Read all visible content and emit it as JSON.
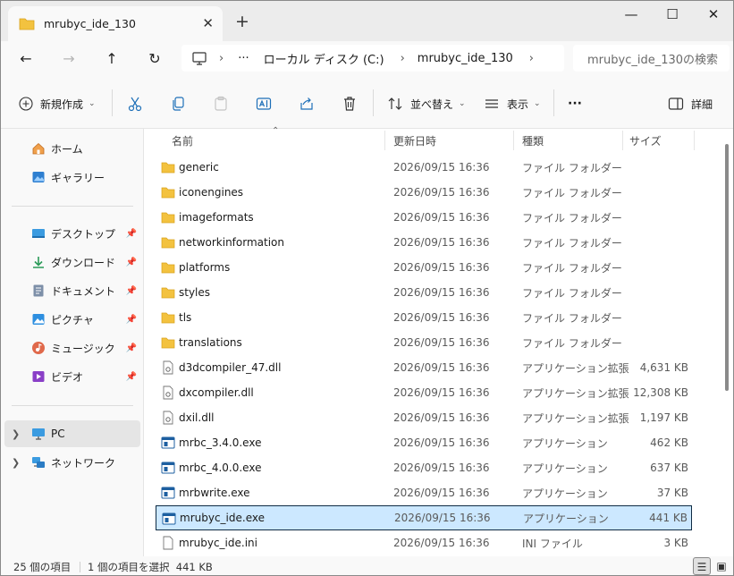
{
  "tab": {
    "title": "mrubyc_ide_130"
  },
  "window": {
    "minimize": "—",
    "maximize": "☐",
    "close": "✕",
    "new_tab": "+",
    "tab_close": "✕"
  },
  "nav": {
    "back": "←",
    "forward": "→",
    "up": "↑",
    "refresh": "↻"
  },
  "address": {
    "overflow": "···",
    "sep": "›",
    "crumbs": [
      "ローカル ディスク (C:)",
      "mrubyc_ide_130"
    ]
  },
  "search": {
    "placeholder": "mrubyc_ide_130の検索"
  },
  "toolbar": {
    "new": "新規作成",
    "sort": "並べ替え",
    "view": "表示",
    "more": "···",
    "details": "詳細"
  },
  "sidebar": {
    "home": "ホーム",
    "gallery": "ギャラリー",
    "quick": [
      "デスクトップ",
      "ダウンロード",
      "ドキュメント",
      "ピクチャ",
      "ミュージック",
      "ビデオ"
    ],
    "pc": "PC",
    "network": "ネットワーク"
  },
  "columns": {
    "name": "名前",
    "date": "更新日時",
    "type": "種類",
    "size": "サイズ"
  },
  "files": [
    {
      "name": "generic",
      "date": "2026/09/15 16:36",
      "type": "ファイル フォルダー",
      "size": "",
      "kind": "folder"
    },
    {
      "name": "iconengines",
      "date": "2026/09/15 16:36",
      "type": "ファイル フォルダー",
      "size": "",
      "kind": "folder"
    },
    {
      "name": "imageformats",
      "date": "2026/09/15 16:36",
      "type": "ファイル フォルダー",
      "size": "",
      "kind": "folder"
    },
    {
      "name": "networkinformation",
      "date": "2026/09/15 16:36",
      "type": "ファイル フォルダー",
      "size": "",
      "kind": "folder"
    },
    {
      "name": "platforms",
      "date": "2026/09/15 16:36",
      "type": "ファイル フォルダー",
      "size": "",
      "kind": "folder"
    },
    {
      "name": "styles",
      "date": "2026/09/15 16:36",
      "type": "ファイル フォルダー",
      "size": "",
      "kind": "folder"
    },
    {
      "name": "tls",
      "date": "2026/09/15 16:36",
      "type": "ファイル フォルダー",
      "size": "",
      "kind": "folder"
    },
    {
      "name": "translations",
      "date": "2026/09/15 16:36",
      "type": "ファイル フォルダー",
      "size": "",
      "kind": "folder"
    },
    {
      "name": "d3dcompiler_47.dll",
      "date": "2026/09/15 16:36",
      "type": "アプリケーション拡張",
      "size": "4,631 KB",
      "kind": "dll"
    },
    {
      "name": "dxcompiler.dll",
      "date": "2026/09/15 16:36",
      "type": "アプリケーション拡張",
      "size": "12,308 KB",
      "kind": "dll"
    },
    {
      "name": "dxil.dll",
      "date": "2026/09/15 16:36",
      "type": "アプリケーション拡張",
      "size": "1,197 KB",
      "kind": "dll"
    },
    {
      "name": "mrbc_3.4.0.exe",
      "date": "2026/09/15 16:36",
      "type": "アプリケーション",
      "size": "462 KB",
      "kind": "exe"
    },
    {
      "name": "mrbc_4.0.0.exe",
      "date": "2026/09/15 16:36",
      "type": "アプリケーション",
      "size": "637 KB",
      "kind": "exe"
    },
    {
      "name": "mrbwrite.exe",
      "date": "2026/09/15 16:36",
      "type": "アプリケーション",
      "size": "37 KB",
      "kind": "exe"
    },
    {
      "name": "mrubyc_ide.exe",
      "date": "2026/09/15 16:36",
      "type": "アプリケーション",
      "size": "441 KB",
      "kind": "exe",
      "selected": true
    },
    {
      "name": "mrubyc_ide.ini",
      "date": "2026/09/15 16:36",
      "type": "INI ファイル",
      "size": "3 KB",
      "kind": "ini"
    }
  ],
  "status": {
    "count": "25 個の項目",
    "selection": "1 個の項目を選択  441 KB"
  },
  "colors": {
    "accent": "#0067c0",
    "selection_bg": "#cce8ff",
    "folder": "#f3c23f"
  }
}
